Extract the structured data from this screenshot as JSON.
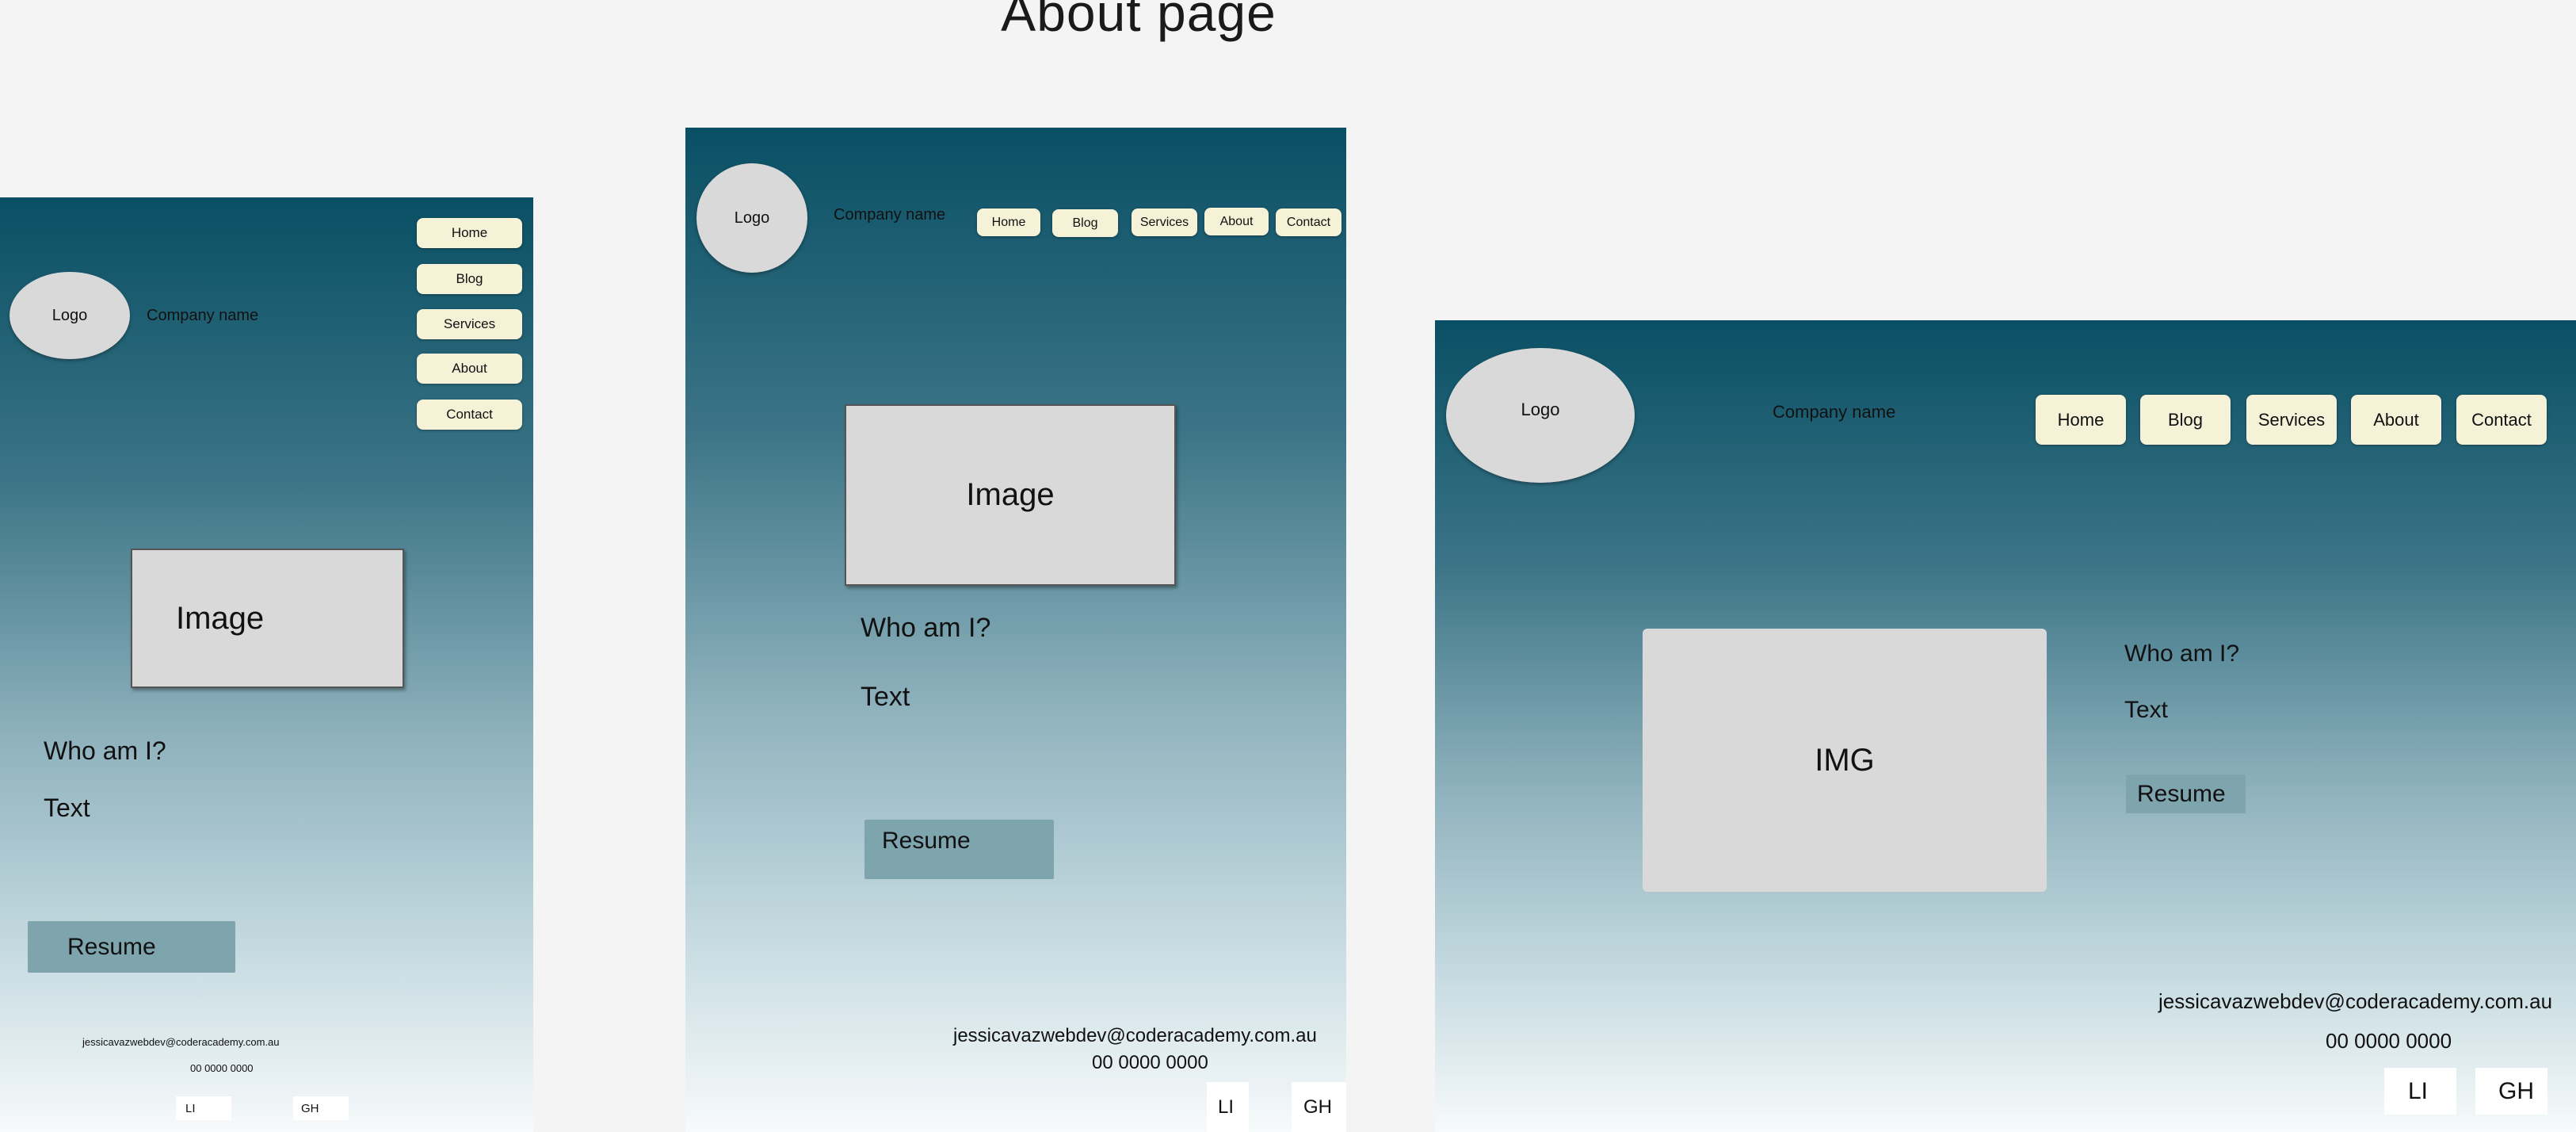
{
  "page_title": "About page",
  "wireframes": [
    {
      "name": "mobile",
      "logo": "Logo",
      "company": "Company name",
      "nav": [
        "Home",
        "Blog",
        "Services",
        "About",
        "Contact"
      ],
      "image": "Image",
      "heading": "Who am I?",
      "text": "Text",
      "resume": "Resume",
      "email": "jessicavazwebdev@coderacademy.com.au",
      "phone": "00 0000 0000",
      "social": [
        "LI",
        "GH"
      ]
    },
    {
      "name": "tablet",
      "logo": "Logo",
      "company": "Company name",
      "nav": [
        "Home",
        "Blog",
        "Services",
        "About",
        "Contact"
      ],
      "image": "Image",
      "heading": "Who am I?",
      "text": "Text",
      "resume": "Resume",
      "email": "jessicavazwebdev@coderacademy.com.au",
      "phone": "00 0000 0000",
      "social": [
        "LI",
        "GH"
      ]
    },
    {
      "name": "desktop",
      "logo": "Logo",
      "company": "Company name",
      "nav": [
        "Home",
        "Blog",
        "Services",
        "About",
        "Contact"
      ],
      "image": "IMG",
      "heading": "Who am I?",
      "text": "Text",
      "resume": "Resume",
      "email": "jessicavazwebdev@coderacademy.com.au",
      "phone": "00 0000 0000",
      "social": [
        "LI",
        "GH"
      ]
    }
  ],
  "colors": {
    "frame_top": "#094f64",
    "frame_bottom": "#f7fafb",
    "nav_button": "#f5f2d8",
    "image_placeholder": "#d9d9d9",
    "resume_button": "#7ea4ae"
  }
}
